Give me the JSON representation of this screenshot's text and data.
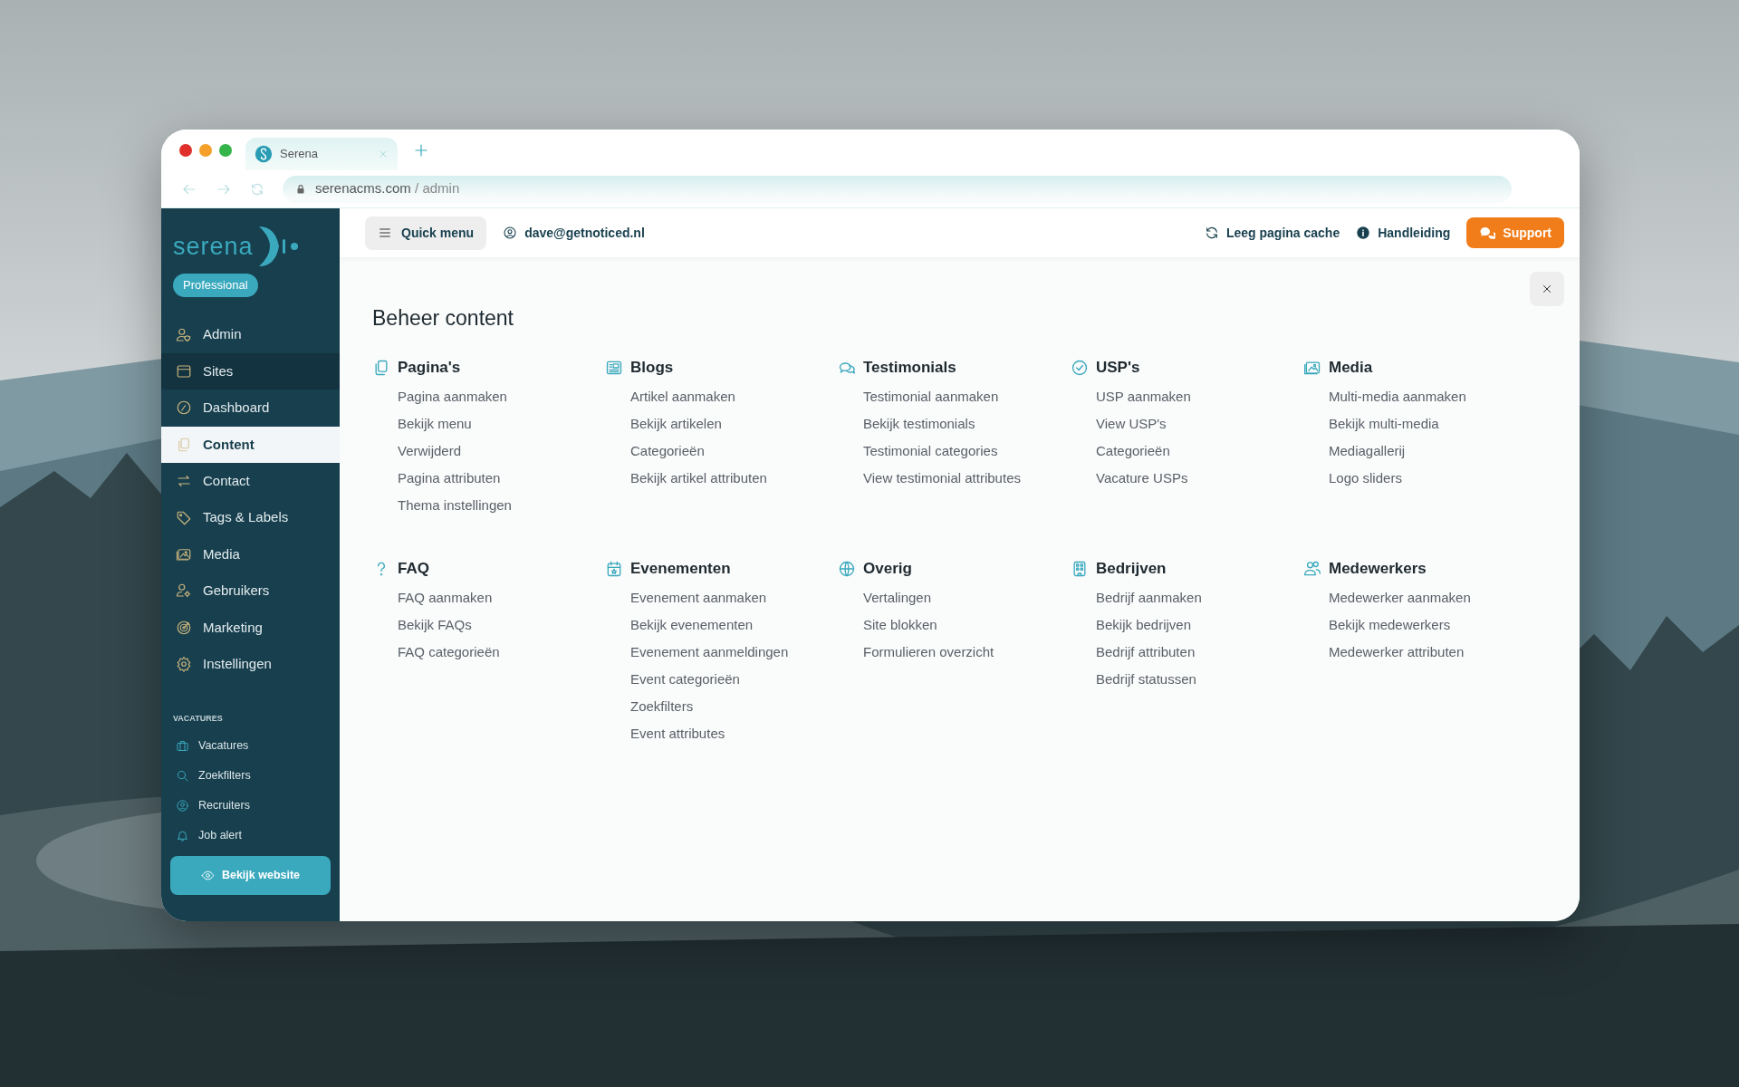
{
  "browser": {
    "tab_title": "Serena",
    "url_domain": "serenacms.com",
    "url_path": "/ admin"
  },
  "sidebar": {
    "logo_text": "serena",
    "plan_badge": "Professional",
    "items": [
      {
        "label": "Admin",
        "selected": false,
        "hovered": false
      },
      {
        "label": "Sites",
        "selected": false,
        "hovered": true
      },
      {
        "label": "Dashboard",
        "selected": false,
        "hovered": false
      },
      {
        "label": "Content",
        "selected": true,
        "hovered": false
      },
      {
        "label": "Contact",
        "selected": false,
        "hovered": false
      },
      {
        "label": "Tags & Labels",
        "selected": false,
        "hovered": false
      },
      {
        "label": "Media",
        "selected": false,
        "hovered": false
      },
      {
        "label": "Gebruikers",
        "selected": false,
        "hovered": false
      },
      {
        "label": "Marketing",
        "selected": false,
        "hovered": false
      },
      {
        "label": "Instellingen",
        "selected": false,
        "hovered": false
      }
    ],
    "section_title": "VACATURES",
    "section_items": [
      "Vacatures",
      "Zoekfilters",
      "Recruiters",
      "Job alert"
    ],
    "website_button": "Bekijk website"
  },
  "topbar": {
    "quick_menu": "Quick menu",
    "user": "dave@getnoticed.nl",
    "clear_cache": "Leeg pagina cache",
    "manual": "Handleiding",
    "support": "Support"
  },
  "panel": {
    "title": "Beheer content",
    "groups": [
      {
        "title": "Pagina's",
        "links": [
          "Pagina aanmaken",
          "Bekijk menu",
          "Verwijderd",
          "Pagina attributen",
          "Thema instellingen"
        ]
      },
      {
        "title": "Blogs",
        "links": [
          "Artikel aanmaken",
          "Bekijk artikelen",
          "Categorieën",
          "Bekijk artikel attributen"
        ]
      },
      {
        "title": "Testimonials",
        "links": [
          "Testimonial aanmaken",
          "Bekijk testimonials",
          "Testimonial categories",
          "View testimonial attributes"
        ]
      },
      {
        "title": "USP's",
        "links": [
          "USP aanmaken",
          "View USP's",
          "Categorieën",
          "Vacature USPs"
        ]
      },
      {
        "title": "Media",
        "links": [
          "Multi-media aanmaken",
          "Bekijk multi-media",
          "Mediagallerij",
          "Logo sliders"
        ]
      },
      {
        "title": "FAQ",
        "links": [
          "FAQ aanmaken",
          "Bekijk FAQs",
          "FAQ categorieën"
        ]
      },
      {
        "title": "Evenementen",
        "links": [
          "Evenement aanmaken",
          "Bekijk evenementen",
          "Evenement aanmeldingen",
          "Event categorieën",
          "Zoekfilters",
          "Event attributes"
        ]
      },
      {
        "title": "Overig",
        "links": [
          "Vertalingen",
          "Site blokken",
          "Formulieren overzicht"
        ]
      },
      {
        "title": "Bedrijven",
        "links": [
          "Bedrijf aanmaken",
          "Bekijk bedrijven",
          "Bedrijf attributen",
          "Bedrijf statussen"
        ]
      },
      {
        "title": "Medewerkers",
        "links": [
          "Medewerker aanmaken",
          "Bekijk medewerkers",
          "Medewerker attributen"
        ]
      }
    ]
  }
}
